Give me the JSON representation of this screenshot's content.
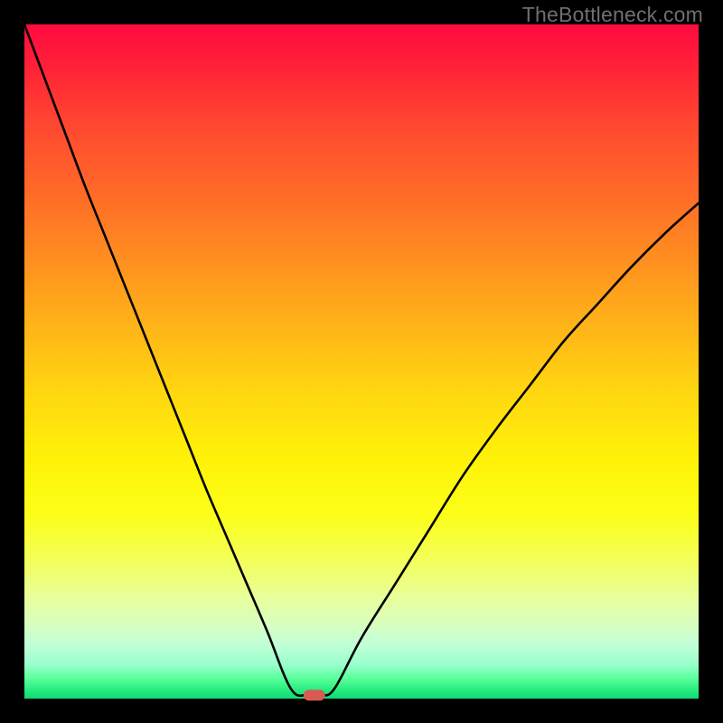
{
  "watermark": "TheBottleneck.com",
  "chart_data": {
    "type": "line",
    "title": "",
    "xlabel": "",
    "ylabel": "",
    "xlim": [
      0,
      100
    ],
    "ylim": [
      0,
      100
    ],
    "grid": false,
    "legend": false,
    "series": [
      {
        "name": "bottleneck-curve",
        "x": [
          0,
          3,
          6,
          9,
          12,
          15,
          18,
          21,
          24,
          27,
          30,
          33,
          36,
          39.5,
          42,
          44,
          46,
          50,
          55,
          60,
          65,
          70,
          75,
          80,
          85,
          90,
          95,
          100
        ],
        "y": [
          100,
          92,
          84,
          76,
          68.5,
          61,
          53.5,
          46,
          38.5,
          31,
          24,
          17,
          10,
          1.5,
          0.5,
          0.5,
          1.5,
          9,
          17,
          25,
          33,
          40,
          46.5,
          53,
          58.5,
          64,
          69,
          73.5
        ]
      }
    ],
    "minimum_marker": {
      "x": 43,
      "y": 0.5
    },
    "colors": {
      "gradient_top": "#ff0a40",
      "gradient_bottom": "#10d878",
      "curve": "#000000",
      "marker": "#d85a52",
      "frame": "#000000"
    }
  }
}
